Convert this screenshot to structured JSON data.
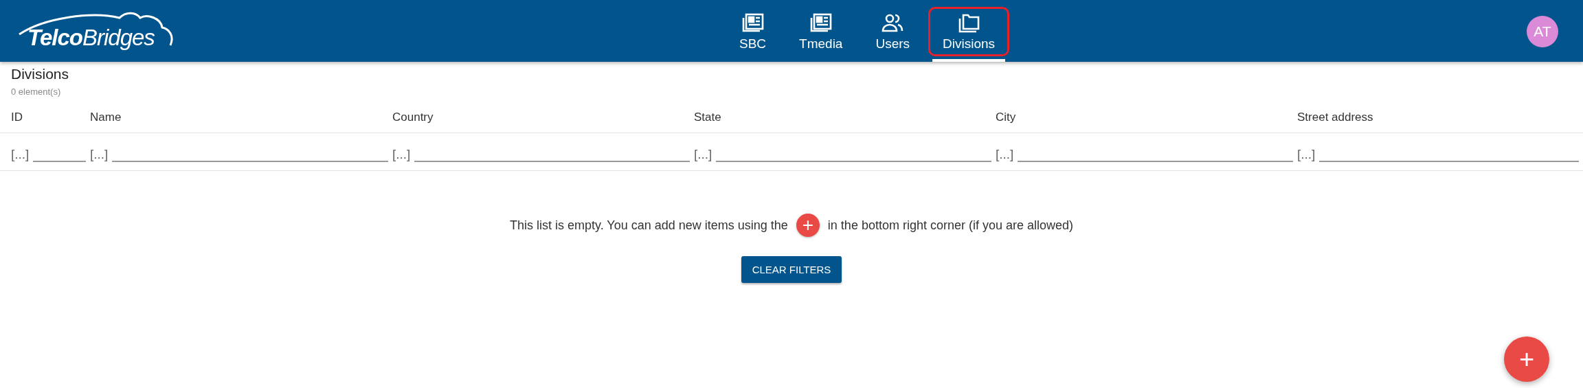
{
  "header": {
    "logo": "**Telco**Bridges",
    "nav": [
      {
        "label": "SBC",
        "kind": "news",
        "selected": false
      },
      {
        "label": "Tmedia",
        "kind": "news",
        "selected": false
      },
      {
        "label": "Users",
        "kind": "users",
        "selected": false
      },
      {
        "label": "Divisions",
        "kind": "folders",
        "selected": true
      }
    ],
    "avatar": "AT"
  },
  "page": {
    "title": "Divisions",
    "count": "0 element(s)"
  },
  "table": {
    "columns": [
      {
        "label": "ID",
        "filter_symbol": "[...]"
      },
      {
        "label": "Name",
        "filter_symbol": "[...]"
      },
      {
        "label": "Country",
        "filter_symbol": "[...]"
      },
      {
        "label": "State",
        "filter_symbol": "[...]"
      },
      {
        "label": "City",
        "filter_symbol": "[...]"
      },
      {
        "label": "Street address",
        "filter_symbol": "[...]"
      }
    ]
  },
  "empty": {
    "before": "This list is empty. You can add new items using the",
    "after": "in the bottom right corner (if you are allowed)",
    "button": "CLEAR FILTERS"
  },
  "fab": {
    "label": "+"
  }
}
